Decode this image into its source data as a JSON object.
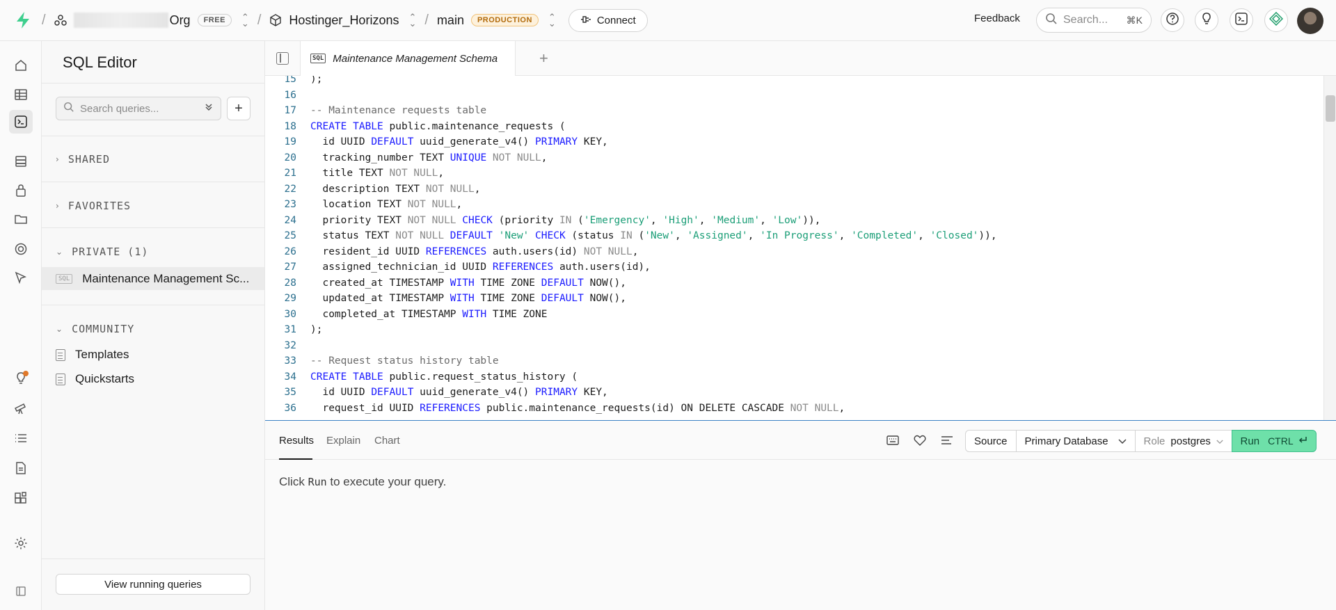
{
  "topbar": {
    "org_name": "Org",
    "org_plan": "FREE",
    "project": "Hostinger_Horizons",
    "branch": "main",
    "branch_env": "PRODUCTION",
    "connect_label": "Connect",
    "feedback_label": "Feedback",
    "search_placeholder": "Search...",
    "search_shortcut": "⌘K"
  },
  "sidebar": {
    "title": "SQL Editor",
    "search_placeholder": "Search queries...",
    "sections": {
      "shared": "SHARED",
      "favorites": "FAVORITES",
      "private": "PRIVATE (1)",
      "community": "COMMUNITY"
    },
    "private_items": [
      {
        "chip": "SQL",
        "label": "Maintenance Management Sc..."
      }
    ],
    "community_items": [
      {
        "label": "Templates"
      },
      {
        "label": "Quickstarts"
      }
    ],
    "view_running_label": "View running queries"
  },
  "tabs": {
    "active_tab_chip": "SQL",
    "active_tab_label": "Maintenance Management Schema",
    "add_label": "+"
  },
  "editor": {
    "lines": [
      {
        "n": "15",
        "html": ");"
      },
      {
        "n": "16",
        "html": ""
      },
      {
        "n": "17",
        "html": "<span class=\"cm\">-- Maintenance requests table</span>"
      },
      {
        "n": "18",
        "html": "<span class=\"kw\">CREATE TABLE</span> public.maintenance_requests ("
      },
      {
        "n": "19",
        "html": "  id UUID <span class=\"kw\">DEFAULT</span> uuid_generate_v4() <span class=\"kw\">PRIMARY</span> KEY,"
      },
      {
        "n": "20",
        "html": "  tracking_number TEXT <span class=\"kw\">UNIQUE</span> <span class=\"nl\">NOT NULL</span>,"
      },
      {
        "n": "21",
        "html": "  title TEXT <span class=\"nl\">NOT NULL</span>,"
      },
      {
        "n": "22",
        "html": "  description TEXT <span class=\"nl\">NOT NULL</span>,"
      },
      {
        "n": "23",
        "html": "  location TEXT <span class=\"nl\">NOT NULL</span>,"
      },
      {
        "n": "24",
        "html": "  priority TEXT <span class=\"nl\">NOT NULL</span> <span class=\"kw\">CHECK</span> (priority <span class=\"nl\">IN</span> (<span class=\"str\">'Emergency'</span>, <span class=\"str\">'High'</span>, <span class=\"str\">'Medium'</span>, <span class=\"str\">'Low'</span>)),"
      },
      {
        "n": "25",
        "html": "  status TEXT <span class=\"nl\">NOT NULL</span> <span class=\"kw\">DEFAULT</span> <span class=\"str\">'New'</span> <span class=\"kw\">CHECK</span> (status <span class=\"nl\">IN</span> (<span class=\"str\">'New'</span>, <span class=\"str\">'Assigned'</span>, <span class=\"str\">'In Progress'</span>, <span class=\"str\">'Completed'</span>, <span class=\"str\">'Closed'</span>)),"
      },
      {
        "n": "26",
        "html": "  resident_id UUID <span class=\"kw\">REFERENCES</span> auth.users(id) <span class=\"nl\">NOT NULL</span>,"
      },
      {
        "n": "27",
        "html": "  assigned_technician_id UUID <span class=\"kw\">REFERENCES</span> auth.users(id),"
      },
      {
        "n": "28",
        "html": "  created_at TIMESTAMP <span class=\"kw\">WITH</span> TIME ZONE <span class=\"kw\">DEFAULT</span> NOW(),"
      },
      {
        "n": "29",
        "html": "  updated_at TIMESTAMP <span class=\"kw\">WITH</span> TIME ZONE <span class=\"kw\">DEFAULT</span> NOW(),"
      },
      {
        "n": "30",
        "html": "  completed_at TIMESTAMP <span class=\"kw\">WITH</span> TIME ZONE"
      },
      {
        "n": "31",
        "html": ");"
      },
      {
        "n": "32",
        "html": ""
      },
      {
        "n": "33",
        "html": "<span class=\"cm\">-- Request status history table</span>"
      },
      {
        "n": "34",
        "html": "<span class=\"kw\">CREATE TABLE</span> public.request_status_history ("
      },
      {
        "n": "35",
        "html": "  id UUID <span class=\"kw\">DEFAULT</span> uuid_generate_v4() <span class=\"kw\">PRIMARY</span> KEY,"
      },
      {
        "n": "36",
        "html": "  request_id UUID <span class=\"kw\">REFERENCES</span> public.maintenance_requests(id) ON DELETE CASCADE <span class=\"nl\">NOT NULL</span>,"
      }
    ]
  },
  "results": {
    "tabs": [
      "Results",
      "Explain",
      "Chart"
    ],
    "source_label": "Source",
    "database_label": "Primary Database",
    "role_label": "Role",
    "role_value": "postgres",
    "run_label": "Run",
    "run_shortcut": "CTRL",
    "empty_prefix": "Click",
    "empty_run": "Run",
    "empty_suffix": "to execute your query."
  },
  "colors": {
    "run_button": "#6ee0a9",
    "production_badge": "#fdf1dc",
    "logo": "#3ecf8e"
  }
}
